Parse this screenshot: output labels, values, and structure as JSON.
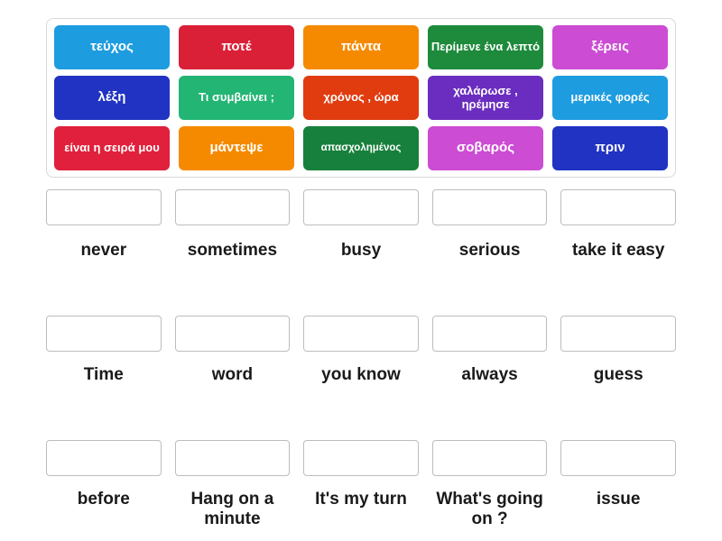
{
  "activity": {
    "type": "match-up-drag-and-drop",
    "colors": {
      "azure": "#1e9ce0",
      "crimson": "#da2037",
      "orange": "#f58a00",
      "green": "#1e8a3c",
      "magenta": "#cc4cd4",
      "blue": "#2033c2",
      "emerald": "#22b573",
      "orange_red": "#e03c10",
      "purple": "#6a2dbf",
      "crimson2": "#e0203c",
      "green_dark": "#17803c"
    }
  },
  "tiles": [
    {
      "id": "tile-1",
      "label": "τεύχος",
      "color": "#1e9ce0",
      "size": "normal"
    },
    {
      "id": "tile-2",
      "label": "ποτέ",
      "color": "#da2037",
      "size": "normal"
    },
    {
      "id": "tile-3",
      "label": "πάντα",
      "color": "#f58a00",
      "size": "normal"
    },
    {
      "id": "tile-4",
      "label": "Περίμενε ένα λεπτό",
      "color": "#1e8a3c",
      "size": "small"
    },
    {
      "id": "tile-5",
      "label": "ξέρεις",
      "color": "#cc4cd4",
      "size": "normal"
    },
    {
      "id": "tile-6",
      "label": "λέξη",
      "color": "#2033c2",
      "size": "normal"
    },
    {
      "id": "tile-7",
      "label": "Τι συμβαίνει ;",
      "color": "#22b573",
      "size": "small"
    },
    {
      "id": "tile-8",
      "label": "χρόνος , ώρα",
      "color": "#e03c10",
      "size": "small"
    },
    {
      "id": "tile-9",
      "label": "χαλάρωσε , ηρέμησε",
      "color": "#6a2dbf",
      "size": "small"
    },
    {
      "id": "tile-10",
      "label": "μερικές φορές",
      "color": "#1e9ce0",
      "size": "small"
    },
    {
      "id": "tile-11",
      "label": "είναι η σειρά μου",
      "color": "#e0203c",
      "size": "small"
    },
    {
      "id": "tile-12",
      "label": "μάντεψε",
      "color": "#f58a00",
      "size": "normal"
    },
    {
      "id": "tile-13",
      "label": "απασχολημένος",
      "color": "#17803c",
      "size": "xsmall"
    },
    {
      "id": "tile-14",
      "label": "σοβαρός",
      "color": "#cc4cd4",
      "size": "normal"
    },
    {
      "id": "tile-15",
      "label": "πριν",
      "color": "#2033c2",
      "size": "normal"
    }
  ],
  "answer_rows": [
    {
      "row": 1,
      "cells": [
        {
          "id": "slot-1",
          "label": "never",
          "value": ""
        },
        {
          "id": "slot-2",
          "label": "sometimes",
          "value": ""
        },
        {
          "id": "slot-3",
          "label": "busy",
          "value": ""
        },
        {
          "id": "slot-4",
          "label": "serious",
          "value": ""
        },
        {
          "id": "slot-5",
          "label": "take it easy",
          "value": ""
        }
      ]
    },
    {
      "row": 2,
      "cells": [
        {
          "id": "slot-6",
          "label": "Time",
          "value": ""
        },
        {
          "id": "slot-7",
          "label": "word",
          "value": ""
        },
        {
          "id": "slot-8",
          "label": "you know",
          "value": ""
        },
        {
          "id": "slot-9",
          "label": "always",
          "value": ""
        },
        {
          "id": "slot-10",
          "label": "guess",
          "value": ""
        }
      ]
    },
    {
      "row": 3,
      "cells": [
        {
          "id": "slot-11",
          "label": "before",
          "value": ""
        },
        {
          "id": "slot-12",
          "label": "Hang on a minute",
          "value": ""
        },
        {
          "id": "slot-13",
          "label": "It's my turn",
          "value": ""
        },
        {
          "id": "slot-14",
          "label": "What's going on ?",
          "value": ""
        },
        {
          "id": "slot-15",
          "label": "issue",
          "value": ""
        }
      ]
    }
  ]
}
